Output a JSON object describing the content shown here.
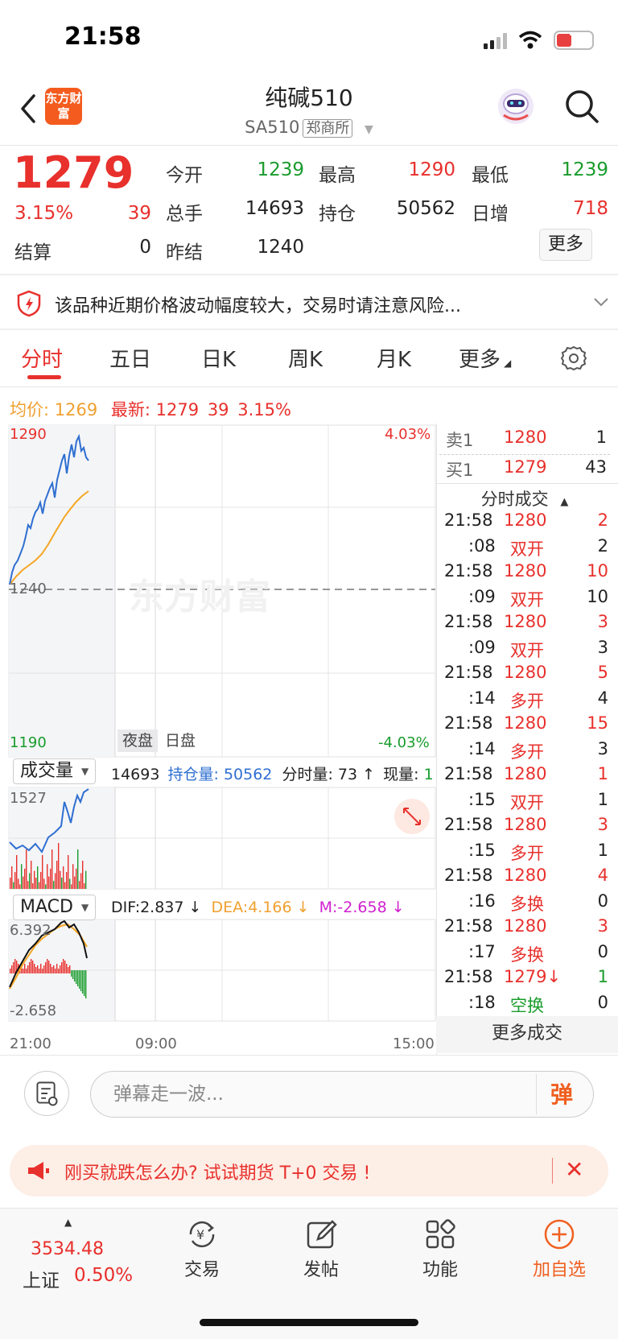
{
  "status": {
    "time": "21:58",
    "battery": "7"
  },
  "nav": {
    "logo": "东方财富",
    "title": "纯碱510",
    "symbol": "SA510",
    "exchange": "郑商所"
  },
  "quote": {
    "price": "1279",
    "pct": "3.15%",
    "change": "39",
    "open_label": "今开",
    "open": "1239",
    "high_label": "最高",
    "high": "1290",
    "low_label": "最低",
    "low": "1239",
    "volume_label": "总手",
    "volume": "14693",
    "oi_label": "持仓",
    "oi": "50562",
    "daily_inc_label": "日增",
    "daily_inc": "718",
    "settle_label": "结算",
    "settle": "0",
    "prev_settle_label": "昨结",
    "prev_settle": "1240",
    "more_label": "更多"
  },
  "risk": {
    "text": "该品种近期价格波动幅度较大，交易时请注意风险..."
  },
  "tabs": [
    "分时",
    "五日",
    "日K",
    "周K",
    "月K",
    "更多"
  ],
  "info": {
    "avg_label": "均价:",
    "avg": "1269",
    "latest_label": "最新:",
    "latest": "1279",
    "chg": "39",
    "pct": "3.15%"
  },
  "chart": {
    "y_top": "1290",
    "y_bottom": "1190",
    "y_mid": "1240",
    "pct_top": "4.03%",
    "pct_bottom": "-4.03%",
    "session_night": "夜盘",
    "session_day": "日盘",
    "watermark": "东方财富",
    "x_labels": [
      "21:00",
      "09:00",
      "15:00"
    ]
  },
  "volume": {
    "selector": "成交量",
    "total": "14693",
    "oi_label": "持仓量:",
    "oi": "50562",
    "tick_label": "分时量:",
    "tick": "73",
    "cur_label": "现量:",
    "cur": "1",
    "y_max": "1527"
  },
  "macd": {
    "selector": "MACD",
    "dif": "DIF:2.837",
    "dea": "DEA:4.166",
    "m": "M:-2.658",
    "y_top": "6.392",
    "y_bottom": "-2.658"
  },
  "order_book": {
    "sell": {
      "label": "卖1",
      "price": "1280",
      "qty": "1"
    },
    "buy": {
      "label": "买1",
      "price": "1279",
      "qty": "43"
    }
  },
  "trades_title": "分时成交",
  "trades": [
    {
      "time": "21:58",
      "price": "1280",
      "qty": "2"
    },
    {
      "time": ":08",
      "price": "双开",
      "qty": "2"
    },
    {
      "time": "21:58",
      "price": "1280",
      "qty": "10"
    },
    {
      "time": ":09",
      "price": "双开",
      "qty": "10"
    },
    {
      "time": "21:58",
      "price": "1280",
      "qty": "3"
    },
    {
      "time": ":09",
      "price": "双开",
      "qty": "3"
    },
    {
      "time": "21:58",
      "price": "1280",
      "qty": "5"
    },
    {
      "time": ":14",
      "price": "多开",
      "qty": "4"
    },
    {
      "time": "21:58",
      "price": "1280",
      "qty": "15"
    },
    {
      "time": ":14",
      "price": "多开",
      "qty": "3"
    },
    {
      "time": "21:58",
      "price": "1280",
      "qty": "1"
    },
    {
      "time": ":15",
      "price": "双开",
      "qty": "1"
    },
    {
      "time": "21:58",
      "price": "1280",
      "qty": "3"
    },
    {
      "time": ":15",
      "price": "多开",
      "qty": "1"
    },
    {
      "time": "21:58",
      "price": "1280",
      "qty": "4"
    },
    {
      "time": ":16",
      "price": "多换",
      "qty": "0"
    },
    {
      "time": "21:58",
      "price": "1280",
      "qty": "3"
    },
    {
      "time": ":17",
      "price": "多换",
      "qty": "0"
    },
    {
      "time": "21:58",
      "price": "1279↓",
      "qty": "1"
    },
    {
      "time": ":18",
      "price": "空换",
      "qty": "0"
    }
  ],
  "more_trades": "更多成交",
  "danmu": {
    "placeholder": "弹幕走一波...",
    "send": "弹"
  },
  "promo": {
    "text": "刚买就跌怎么办? 试试期货 T+0 交易 !",
    "close": "✕"
  },
  "bottom": {
    "index_value": "3534.48",
    "index_name": "上证",
    "index_pct": "0.50%",
    "items": [
      "交易",
      "发帖",
      "功能",
      "加自选"
    ]
  }
}
